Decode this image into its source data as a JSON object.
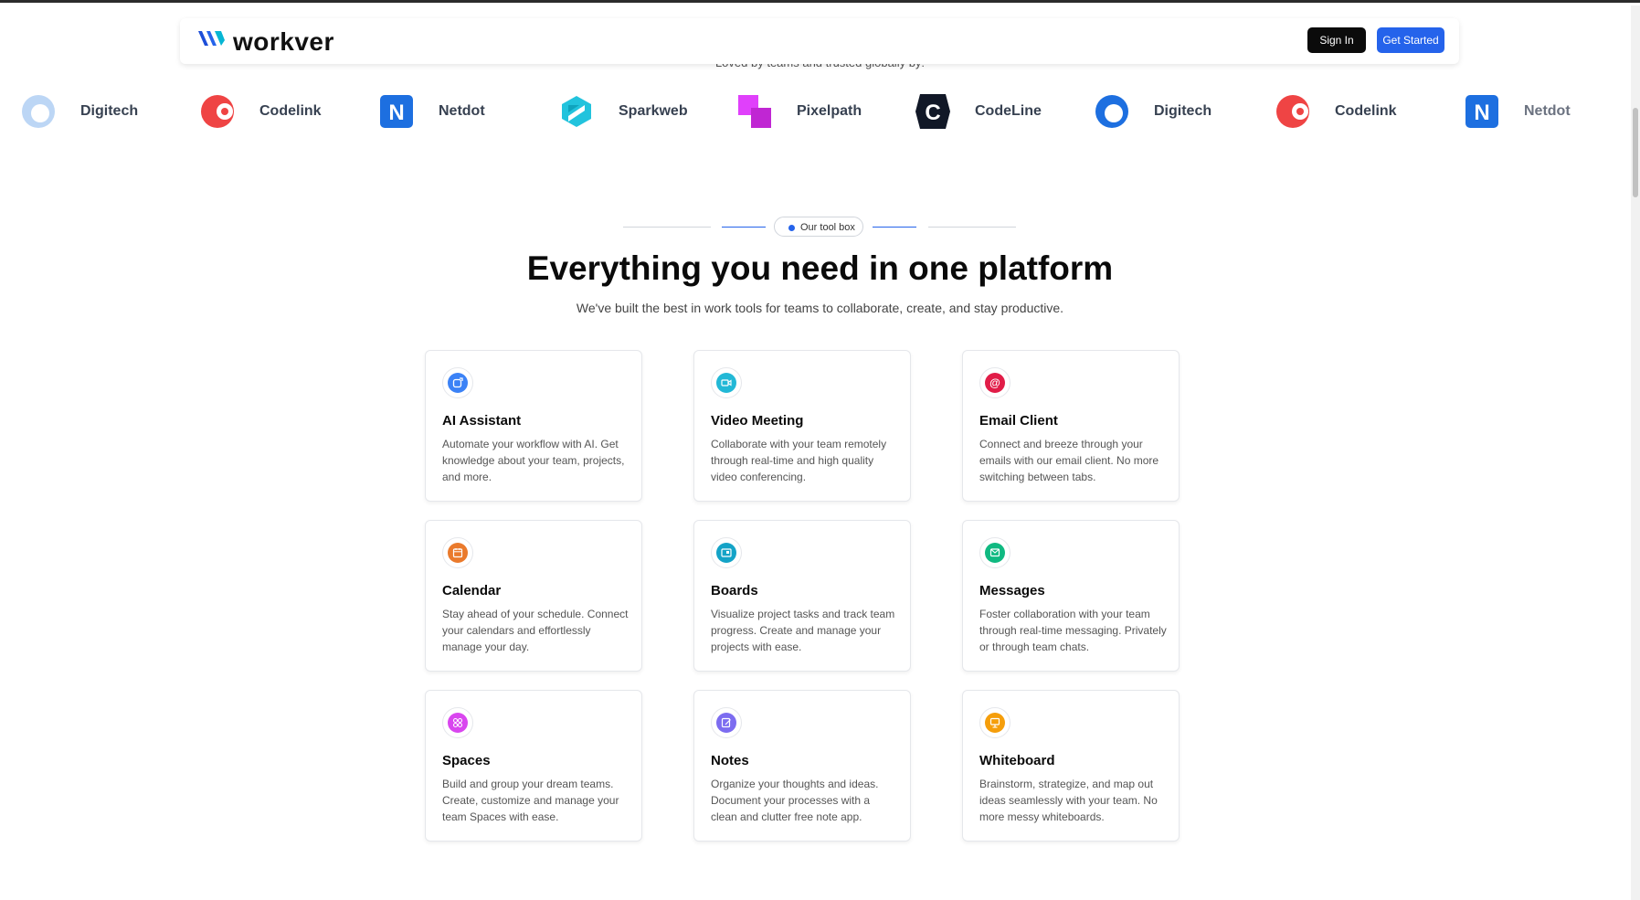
{
  "header": {
    "logo_text": "workver",
    "sign_in": "Sign In",
    "get_started": "Get Started"
  },
  "trusted_text": "Loved by teams and trusted globally by:",
  "brands": [
    {
      "name": "Digitech",
      "icon": "digitech-logo-icon"
    },
    {
      "name": "Codelink",
      "icon": "codelink-logo-icon"
    },
    {
      "name": "Netdot",
      "icon": "netdot-logo-icon"
    },
    {
      "name": "Sparkweb",
      "icon": "sparkweb-logo-icon"
    },
    {
      "name": "Pixelpath",
      "icon": "pixelpath-logo-icon"
    },
    {
      "name": "CodeLine",
      "icon": "codeline-logo-icon"
    },
    {
      "name": "Digitech",
      "icon": "digitech-logo-icon"
    },
    {
      "name": "Codelink",
      "icon": "codelink-logo-icon"
    },
    {
      "name": "Netdot",
      "icon": "netdot-logo-icon"
    }
  ],
  "toolbox": {
    "pill": "Our tool box",
    "title": "Everything you need in one platform",
    "subtitle": "We've built the best in work tools for teams to collaborate, create, and stay productive."
  },
  "colors": {
    "accent": "#2563eb",
    "dark": "#0b0b0b"
  },
  "features": [
    {
      "title": "AI Assistant",
      "desc": "Automate your workflow with AI. Get knowledge about your team, projects, and more.",
      "icon": "ai-assistant-icon",
      "color": "#3b82f6"
    },
    {
      "title": "Video Meeting",
      "desc": "Collaborate with your team remotely through real-time and high quality video conferencing.",
      "icon": "video-camera-icon",
      "color": "#22b8d6"
    },
    {
      "title": "Email Client",
      "desc": "Connect and breeze through your emails with our email client. No more switching between tabs.",
      "icon": "at-sign-icon",
      "color": "#e11d48"
    },
    {
      "title": "Calendar",
      "desc": "Stay ahead of your schedule. Connect your calendars and effortlessly manage your day.",
      "icon": "calendar-icon",
      "color": "#ea7a2c"
    },
    {
      "title": "Boards",
      "desc": "Visualize project tasks and track team progress. Create and manage your projects with ease.",
      "icon": "board-icon",
      "color": "#14a3c7"
    },
    {
      "title": "Messages",
      "desc": "Foster collaboration with your team through real-time messaging. Privately or through team chats.",
      "icon": "message-icon",
      "color": "#10b981"
    },
    {
      "title": "Spaces",
      "desc": "Build and group your dream teams. Create, customize and manage your team Spaces with ease.",
      "icon": "spaces-icon",
      "color": "#d946ef"
    },
    {
      "title": "Notes",
      "desc": "Organize your thoughts and ideas. Document your processes with a clean and clutter free note app.",
      "icon": "note-icon",
      "color": "#7c6cf0"
    },
    {
      "title": "Whiteboard",
      "desc": "Brainstorm, strategize, and map out ideas seamlessly with your team. No more messy whiteboards.",
      "icon": "whiteboard-icon",
      "color": "#f59e0b"
    }
  ]
}
